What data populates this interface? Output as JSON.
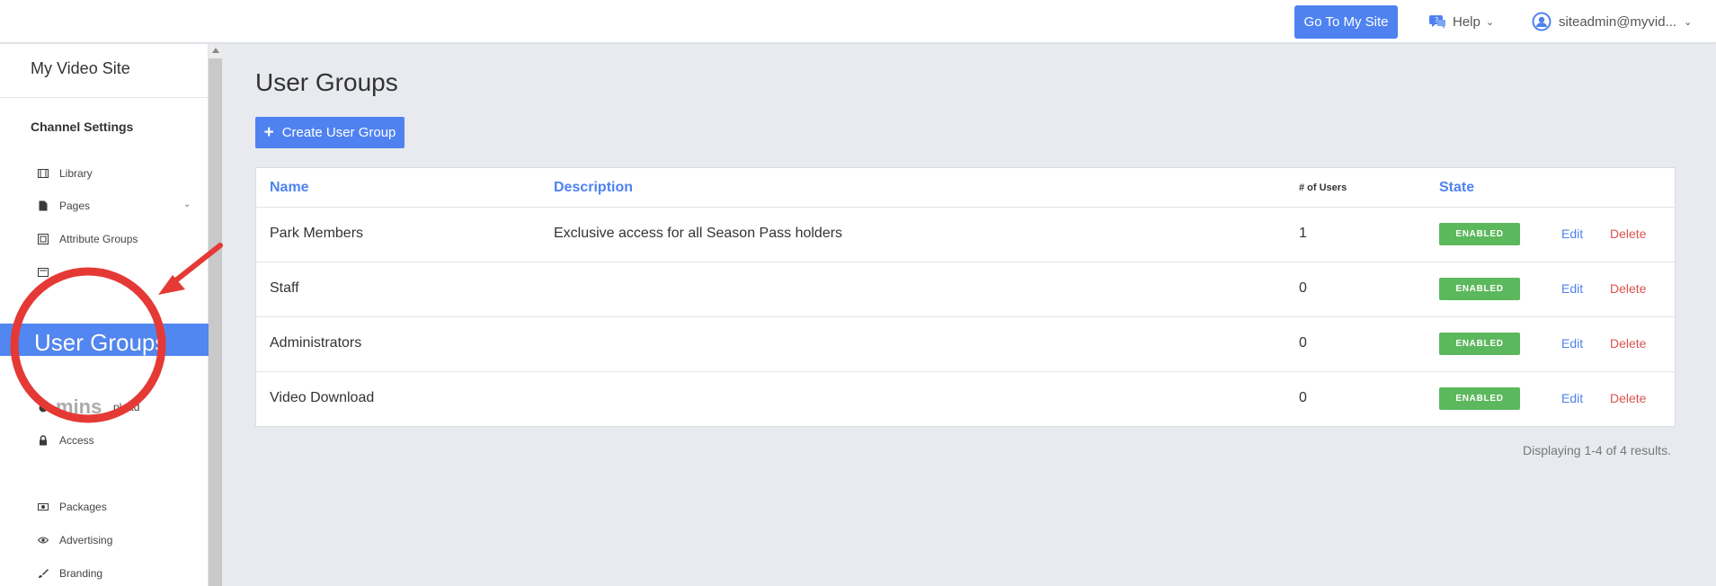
{
  "header": {
    "go_to_site": "Go To My Site",
    "help": "Help",
    "user": "siteadmin@myvid..."
  },
  "sidebar": {
    "site_name": "My Video Site",
    "section": "Channel Settings",
    "items": [
      {
        "label": "Library",
        "icon": "film-icon"
      },
      {
        "label": "Pages",
        "icon": "page-icon"
      },
      {
        "label": "Attribute Groups",
        "icon": "attribute-icon"
      },
      {
        "label": "",
        "icon": "list-icon"
      },
      {
        "label": "pload",
        "icon": "upload-icon"
      },
      {
        "label": "Access",
        "icon": "lock-icon"
      },
      {
        "label": "Packages",
        "icon": "package-icon"
      },
      {
        "label": "Advertising",
        "icon": "eye-icon"
      },
      {
        "label": "Branding",
        "icon": "brush-icon"
      }
    ],
    "highlight_label": "User Groups",
    "ghost_label": "mins"
  },
  "main": {
    "title": "User Groups",
    "create_button": "Create User Group",
    "columns": {
      "name": "Name",
      "description": "Description",
      "users": "# of Users",
      "state": "State"
    },
    "rows": [
      {
        "name": "Park Members",
        "description": "Exclusive access for all Season Pass holders",
        "users": "1",
        "state": "ENABLED",
        "edit": "Edit",
        "delete": "Delete"
      },
      {
        "name": "Staff",
        "description": "",
        "users": "0",
        "state": "ENABLED",
        "edit": "Edit",
        "delete": "Delete"
      },
      {
        "name": "Administrators",
        "description": "",
        "users": "0",
        "state": "ENABLED",
        "edit": "Edit",
        "delete": "Delete"
      },
      {
        "name": "Video Download",
        "description": "",
        "users": "0",
        "state": "ENABLED",
        "edit": "Edit",
        "delete": "Delete"
      }
    ],
    "summary": "Displaying 1-4 of 4 results."
  },
  "colors": {
    "accent": "#4f82f0",
    "enabled": "#5cb85c",
    "delete": "#d9534f",
    "annotation": "#e53935"
  }
}
